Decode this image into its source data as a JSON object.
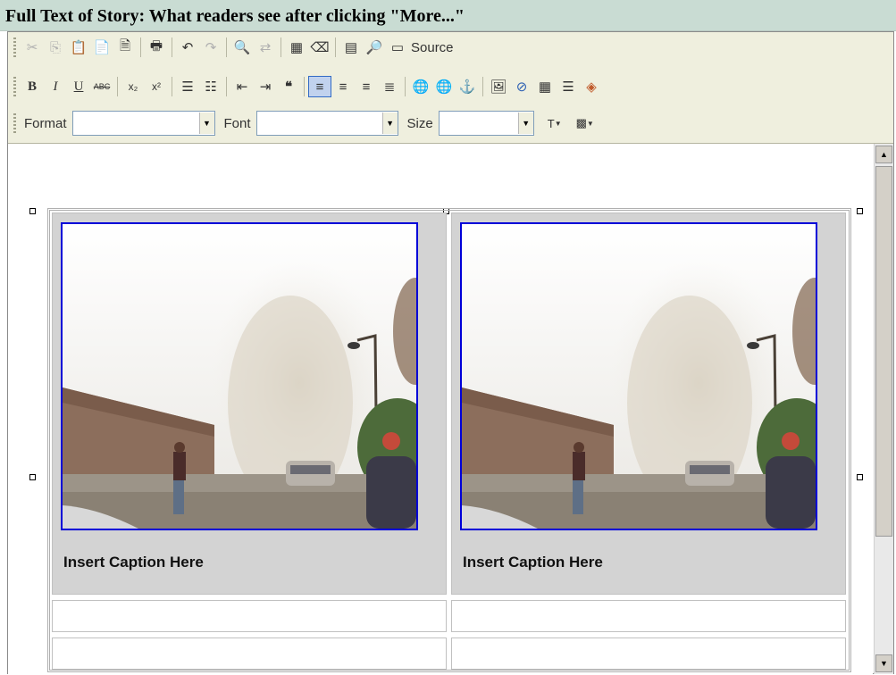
{
  "header": {
    "title": "Full Text of Story: What readers see after clicking \"More...\""
  },
  "toolbar": {
    "source_label": "Source",
    "format_label": "Format",
    "font_label": "Font",
    "size_label": "Size",
    "format_value": "",
    "font_value": "",
    "size_value": "",
    "active_button": "align-left"
  },
  "editor": {
    "table": {
      "photos": [
        {
          "caption": "Insert Caption Here"
        },
        {
          "caption": "Insert Caption Here"
        }
      ]
    }
  },
  "colors": {
    "header_bg": "#c9dcd3",
    "toolbar_bg": "#efefde",
    "photo_border": "#0000d8",
    "cell_bg": "#d3d3d3"
  }
}
